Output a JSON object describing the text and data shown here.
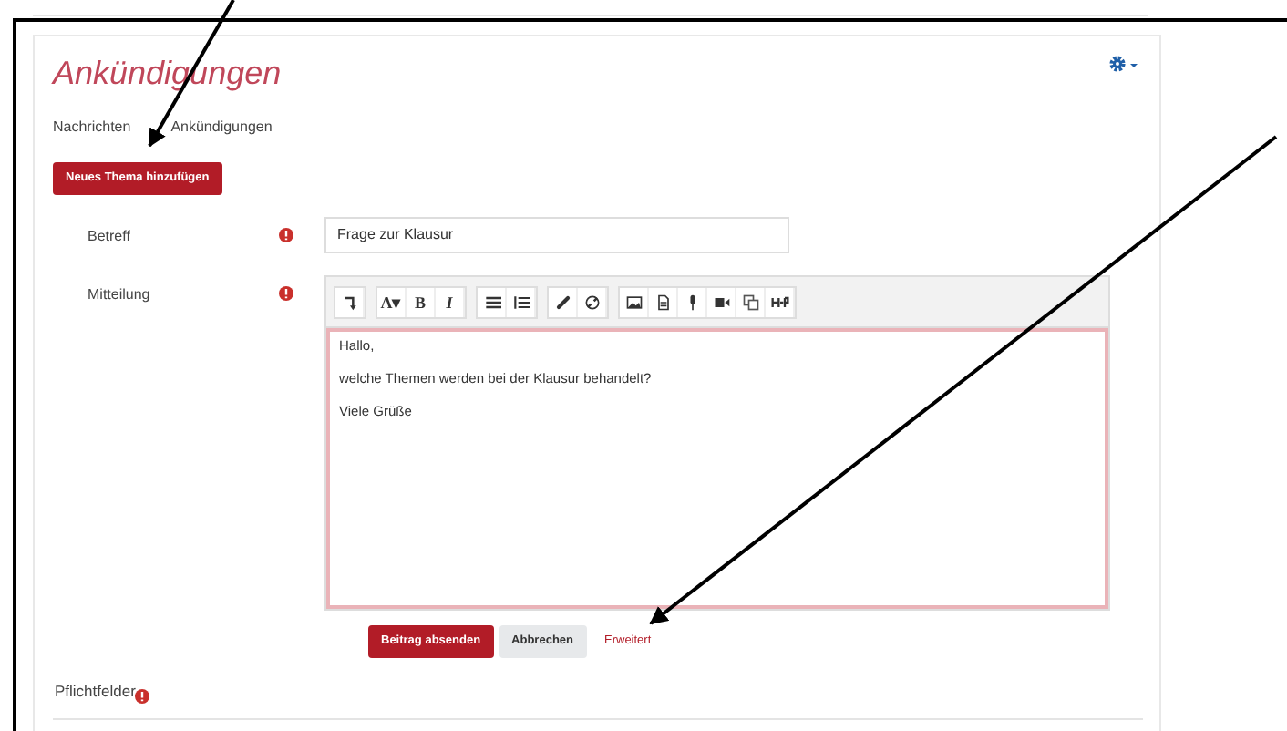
{
  "page": {
    "title": "Ankündigungen",
    "subtitle": [
      "Nachrichten",
      "Ankündigungen"
    ],
    "new_topic_button": "Neues Thema hinzufügen"
  },
  "form": {
    "fields": [
      {
        "label": "Betreff",
        "required": true,
        "kind": "input",
        "value": "Frage zur Klausur"
      },
      {
        "label": "Mitteilung",
        "required": true,
        "kind": "editor",
        "lines": [
          "Hallo,",
          "welche Themen werden bei der Klausur behandelt?",
          "Viele Grüße"
        ]
      }
    ],
    "toolbar": [
      [
        {
          "kind": "collapse"
        }
      ],
      [
        {
          "kind": "text",
          "label": "A▾"
        },
        {
          "kind": "text",
          "label": "B"
        },
        {
          "kind": "text",
          "label": "I",
          "italic": true
        }
      ],
      [
        {
          "kind": "bullets"
        },
        {
          "kind": "numbers"
        }
      ],
      [
        {
          "kind": "link"
        },
        {
          "kind": "unlink"
        }
      ],
      [
        {
          "kind": "image"
        },
        {
          "kind": "file"
        },
        {
          "kind": "mic"
        },
        {
          "kind": "video"
        },
        {
          "kind": "copy"
        },
        {
          "kind": "h5p"
        }
      ]
    ],
    "buttons": [
      {
        "label": "Beitrag absenden",
        "kind": "primary"
      },
      {
        "label": "Abbrechen",
        "kind": "secondary"
      },
      {
        "label": "Erweitert",
        "kind": "link"
      }
    ],
    "required_note": "Pflichtfelder"
  }
}
